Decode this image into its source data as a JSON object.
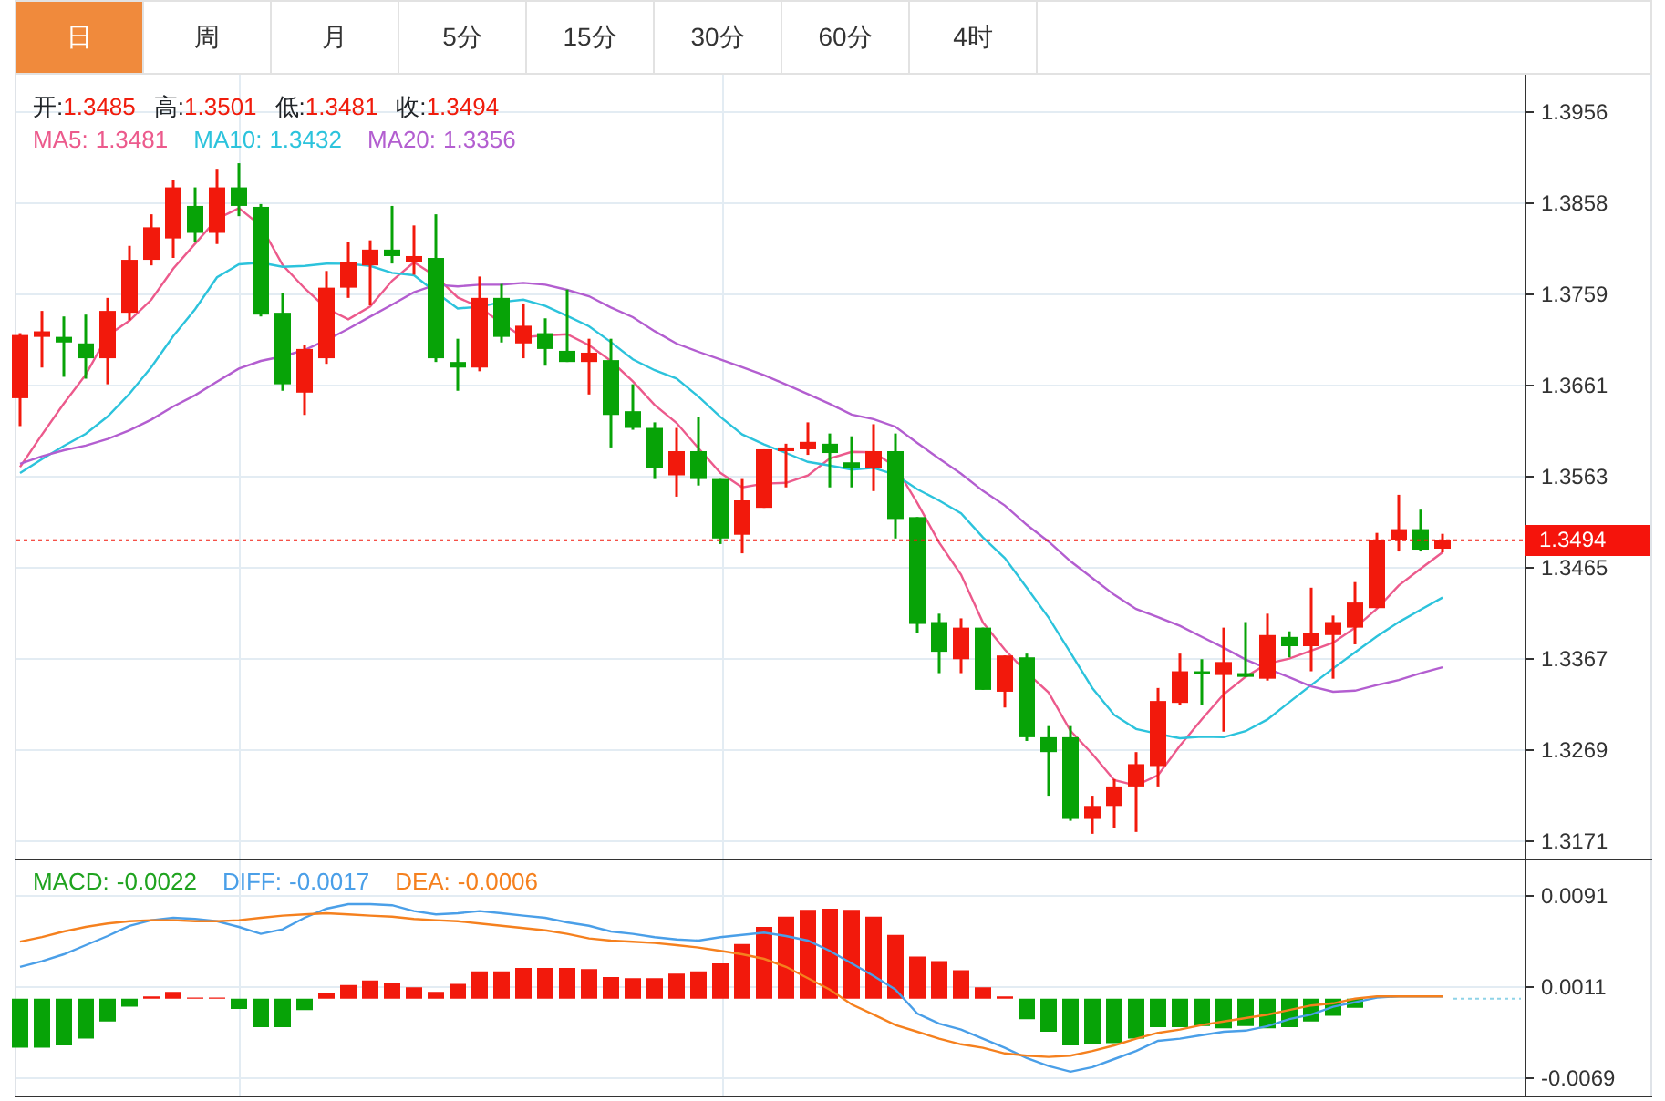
{
  "tabs": [
    {
      "label": "日",
      "selected": true
    },
    {
      "label": "周",
      "selected": false
    },
    {
      "label": "月",
      "selected": false
    },
    {
      "label": "5分",
      "selected": false
    },
    {
      "label": "15分",
      "selected": false
    },
    {
      "label": "30分",
      "selected": false
    },
    {
      "label": "60分",
      "selected": false
    },
    {
      "label": "4时",
      "selected": false
    }
  ],
  "price_chart": {
    "ohlc": [
      {
        "label": "开:",
        "value": "1.3485"
      },
      {
        "label": "高:",
        "value": "1.3501"
      },
      {
        "label": "低:",
        "value": "1.3481"
      },
      {
        "label": "收:",
        "value": "1.3494"
      }
    ],
    "ma_legend": [
      {
        "name": "MA5:",
        "value": "1.3481",
        "color": "#ec5a8c"
      },
      {
        "name": "MA10:",
        "value": "1.3432",
        "color": "#2cc3dc"
      },
      {
        "name": "MA20:",
        "value": "1.3356",
        "color": "#b35ed0"
      }
    ],
    "axis_labels": [
      "1.3956",
      "1.3858",
      "1.3759",
      "1.3661",
      "1.3563",
      "1.3465",
      "1.3367",
      "1.3269",
      "1.3171"
    ],
    "last_price": "1.3494"
  },
  "macd": {
    "legend": [
      {
        "name": "MACD:",
        "value": "-0.0022",
        "color": "#1fa31f"
      },
      {
        "name": "DIFF:",
        "value": "-0.0017",
        "color": "#4a9fe8"
      },
      {
        "name": "DEA:",
        "value": "-0.0006",
        "color": "#f5801e"
      }
    ],
    "axis_labels": [
      "0.0091",
      "0.0011",
      "-0.0069"
    ]
  }
}
